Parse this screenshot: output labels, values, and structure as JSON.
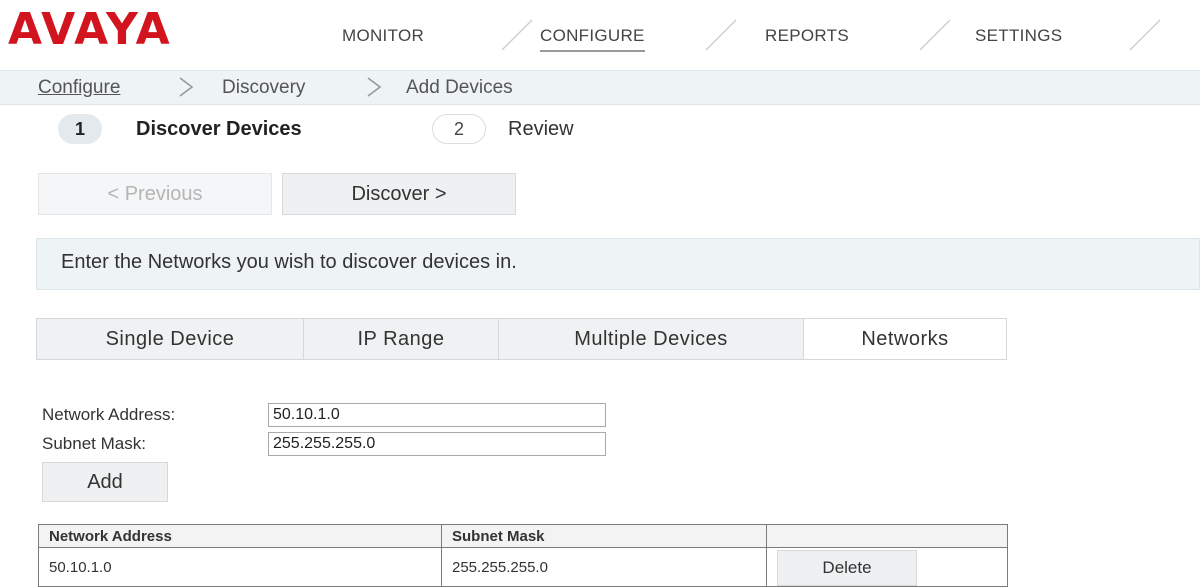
{
  "header": {
    "logo": "AVAYA",
    "nav": [
      "MONITOR",
      "CONFIGURE",
      "REPORTS",
      "SETTINGS"
    ],
    "active_nav": "CONFIGURE"
  },
  "breadcrumb": {
    "items": [
      "Configure",
      "Discovery",
      "Add Devices"
    ],
    "separator": ">"
  },
  "wizard": {
    "steps": [
      {
        "number": "1",
        "label": "Discover Devices",
        "active": true
      },
      {
        "number": "2",
        "label": "Review",
        "active": false
      }
    ],
    "previous_label": "< Previous",
    "discover_label": "Discover >"
  },
  "info": {
    "message": "Enter the Networks you wish to discover devices in."
  },
  "tabs": {
    "items": [
      "Single Device",
      "IP Range",
      "Multiple Devices",
      "Networks"
    ],
    "selected": "Networks"
  },
  "form": {
    "network_address_label": "Network Address:",
    "network_address_value": "50.10.1.0",
    "subnet_mask_label": "Subnet Mask:",
    "subnet_mask_value": "255.255.255.0",
    "add_label": "Add"
  },
  "table": {
    "headers": [
      "Network Address",
      "Subnet Mask",
      ""
    ],
    "rows": [
      {
        "network_address": "50.10.1.0",
        "subnet_mask": "255.255.255.0",
        "action": "Delete"
      }
    ]
  },
  "colors": {
    "brand": "#d2141e",
    "panel_bg": "#eef3f6",
    "button_bg": "#eef0f1"
  }
}
